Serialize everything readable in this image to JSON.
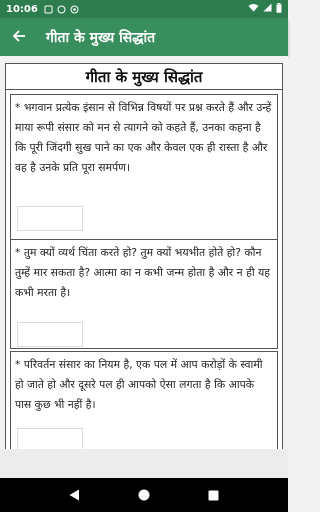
{
  "status_bar": {
    "time": "10:06"
  },
  "app_bar": {
    "title": "गीता के मुख्य सिद्धांत"
  },
  "content": {
    "heading": "गीता के मुख्य सिद्धांत",
    "cards": [
      {
        "text": "* भगवान प्रत्येक इंसान से विभिन्न विषयों पर प्रश्न करते हैं और उन्हें माया रूपी संसार को मन से त्यागने को कहते हैं, उनका कहना है कि पूरी जिंदगी सुख पाने का एक और केवल एक ही रास्ता है और वह है उनके प्रति पूरा समर्पण।"
      },
      {
        "text": "* तुम क्यों व्यर्थ चिंता करते हो? तुम क्यों भयभीत होते हो? कौन तुम्हें मार सकता है? आत्मा का न कभी जन्म होता है और न ही यह कभी मरता है।"
      },
      {
        "text": "* परिवर्तन संसार का नियम है, एक पल में आप करोड़ों के स्वामी हो जाते हो और दूसरे पल ही आपको ऐसा लगता है कि आपके पास कुछ भी नहीं है।"
      }
    ]
  },
  "colors": {
    "status_bar": "#2e7d4f",
    "app_bar": "#388e5c"
  }
}
